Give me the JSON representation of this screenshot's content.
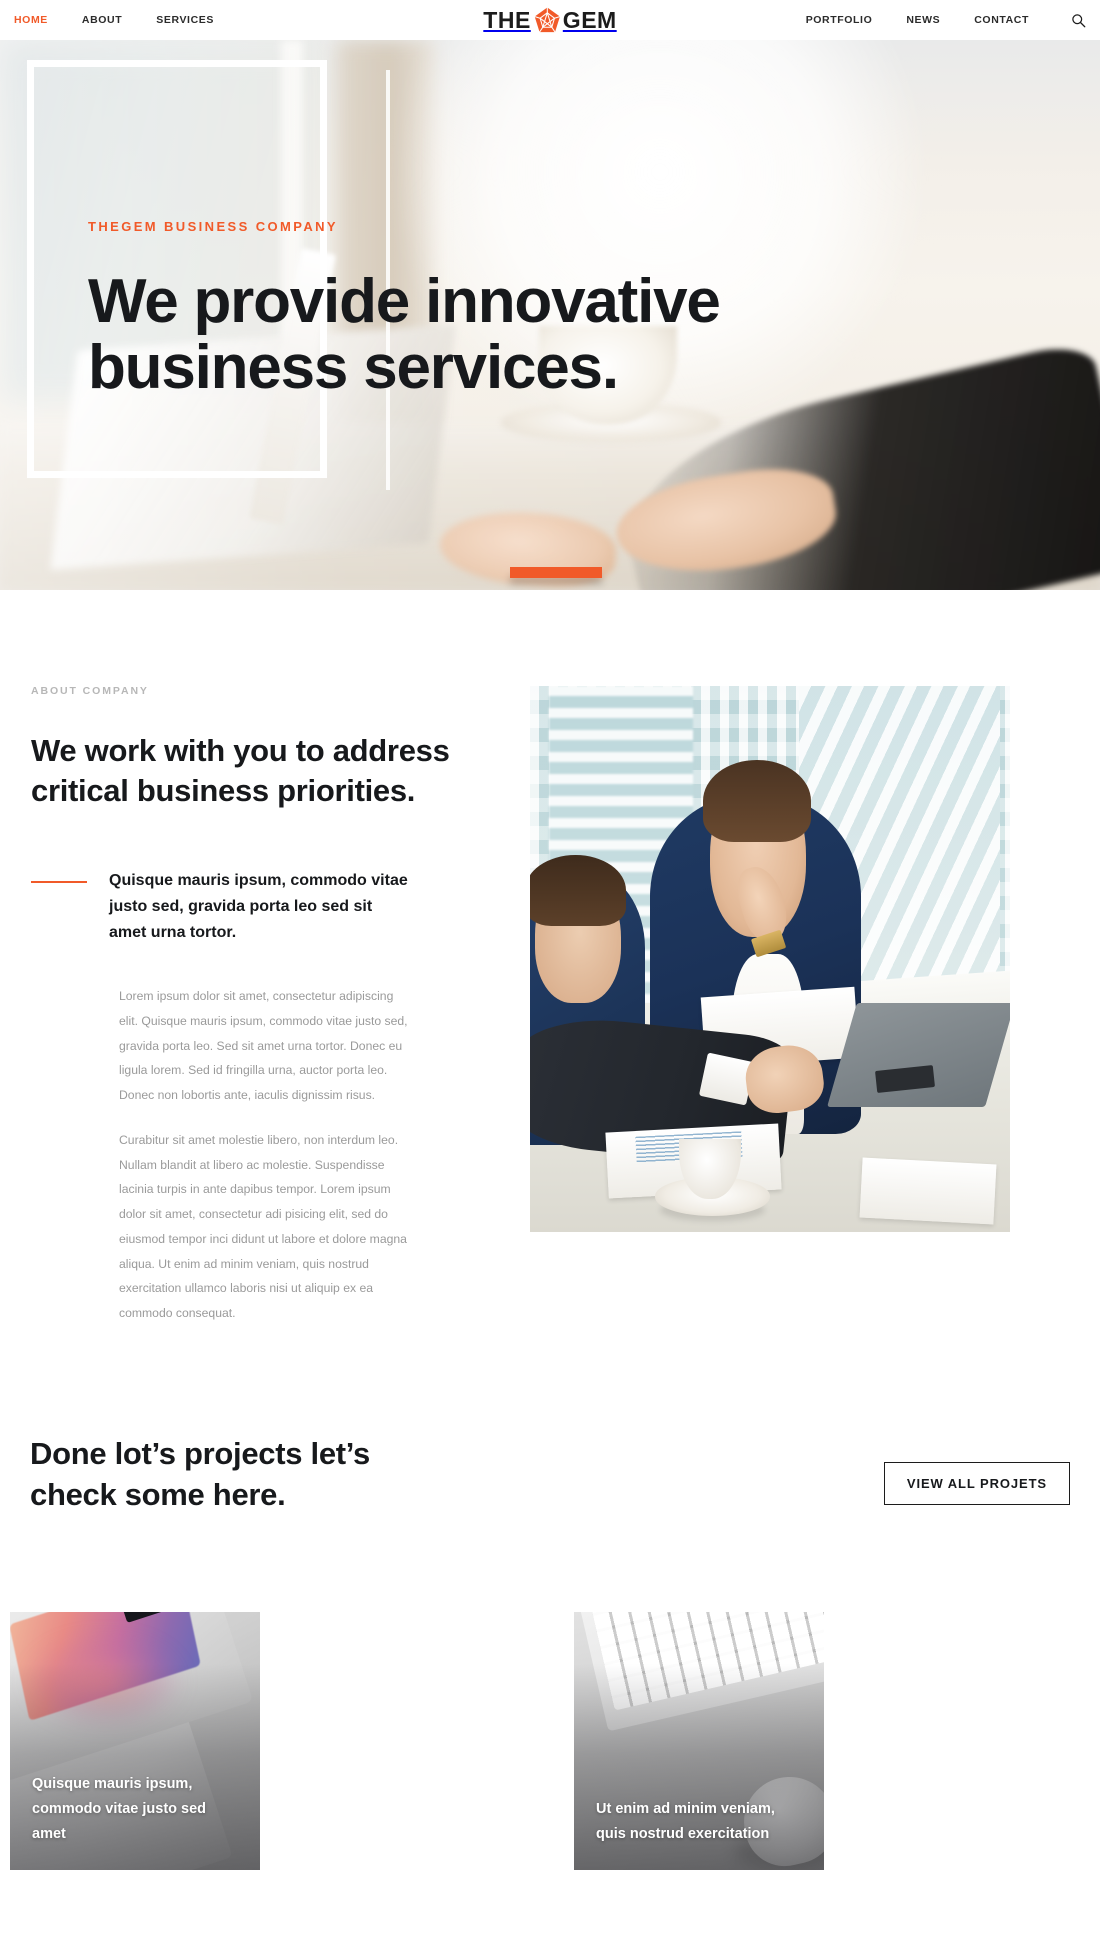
{
  "header": {
    "nav_left": [
      {
        "label": "HOME",
        "active": true
      },
      {
        "label": "ABOUT",
        "active": false
      },
      {
        "label": "SERVICES",
        "active": false
      }
    ],
    "logo": {
      "word1": "THE",
      "word2": "GEM",
      "icon": "gem-pentagon-icon",
      "color": "#f15a29"
    },
    "nav_right": [
      {
        "label": "PORTFOLIO"
      },
      {
        "label": "NEWS"
      },
      {
        "label": "CONTACT"
      }
    ],
    "search_icon": "search-icon"
  },
  "hero": {
    "eyebrow": "THEGEM BUSINESS COMPANY",
    "title_line1": "We provide innovative",
    "title_line2": "business services.",
    "accent_color": "#f15a29"
  },
  "about": {
    "eyebrow": "ABOUT COMPANY",
    "title": "We work with you to address critical business priorities.",
    "lead": "Quisque mauris ipsum, commodo vitae justo sed, gravida porta leo sed sit amet urna tortor.",
    "paragraph1": "Lorem ipsum dolor sit amet, consectetur adipiscing elit. Quisque mauris ipsum, commodo vitae justo sed, gravida porta leo. Sed sit amet urna tortor. Donec eu ligula lorem. Sed id fringilla urna, auctor porta leo. Donec non lobortis ante, iaculis dignissim risus.",
    "paragraph2": "Curabitur sit amet molestie libero, non interdum leo. Nullam blandit at libero ac molestie. Suspendisse lacinia turpis in ante dapibus tempor. Lorem ipsum dolor sit amet, consectetur adi pisicing elit, sed do eiusmod tempor inci didunt ut labore et dolore magna aliqua. Ut enim ad minim veniam, quis nostrud exercitation ullamco laboris nisi ut aliquip ex ea commodo consequat."
  },
  "projects": {
    "title": "Done lot’s projects let’s check some here.",
    "button_label": "VIEW ALL PROJETS",
    "cards": [
      {
        "caption": "Quisque mauris ipsum, commodo vitae justo sed amet"
      },
      {
        "caption": "Ut enim ad minim veniam, quis nostrud exercitation"
      }
    ]
  }
}
